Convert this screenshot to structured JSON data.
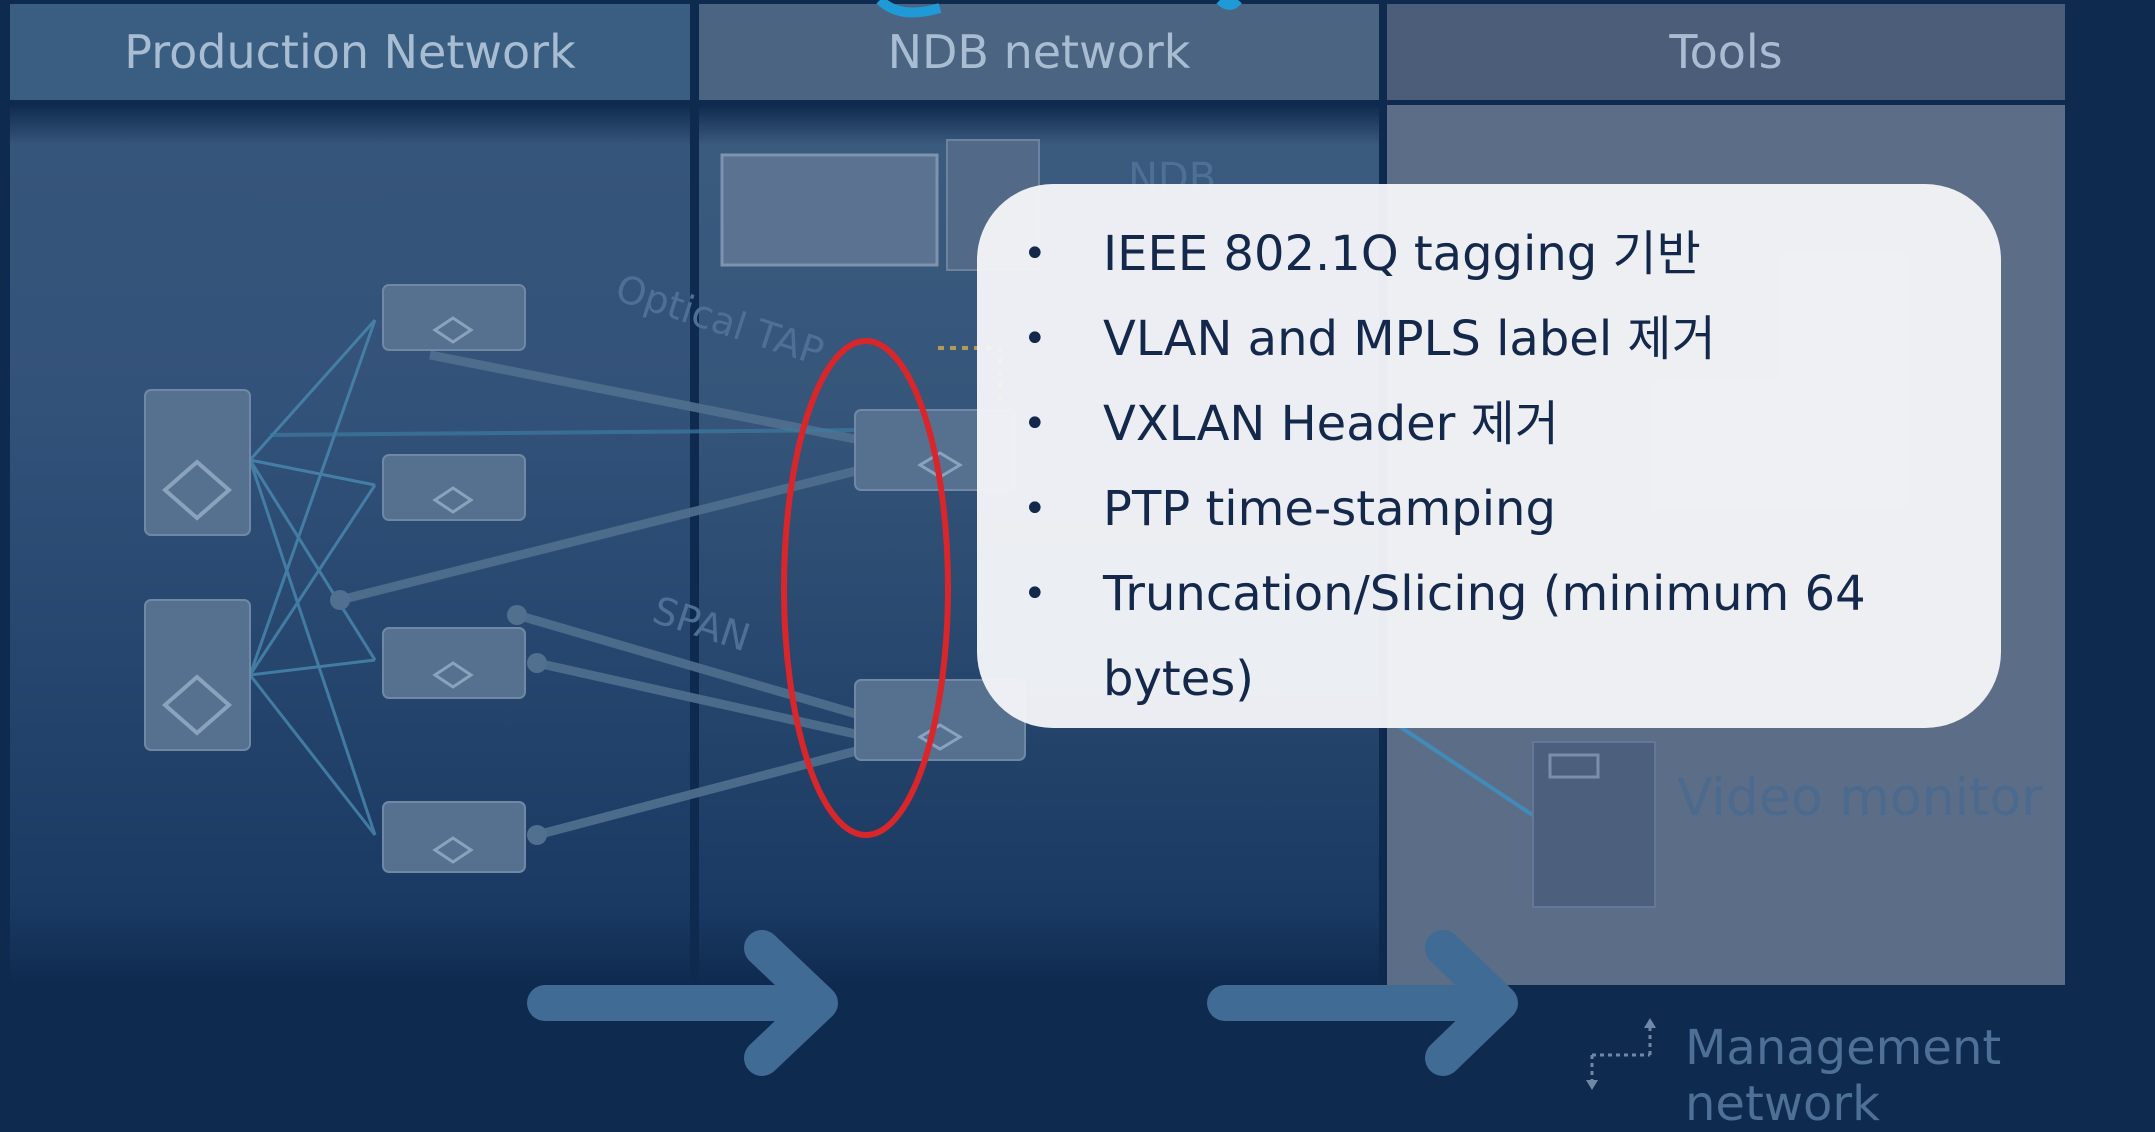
{
  "columns": {
    "production": "Production Network",
    "ndb": "NDB network",
    "tools": "Tools"
  },
  "labels": {
    "ndb_device": "NDB",
    "optical_tap": "Optical TAP",
    "span": "SPAN",
    "video_monitor": "Video monitor",
    "management_network": "Management network"
  },
  "callout": {
    "items": [
      "IEEE 802.1Q tagging 기반",
      "VLAN and MPLS label 제거",
      "VXLAN Header 제거",
      "PTP time-stamping",
      "Truncation/Slicing (minimum 64 bytes)"
    ],
    "bullet": "•"
  },
  "colors": {
    "background": "#0f2a4f",
    "highlight_ellipse": "#d9262b",
    "callout_text": "#13284a",
    "arrow": "#3f6b94"
  }
}
